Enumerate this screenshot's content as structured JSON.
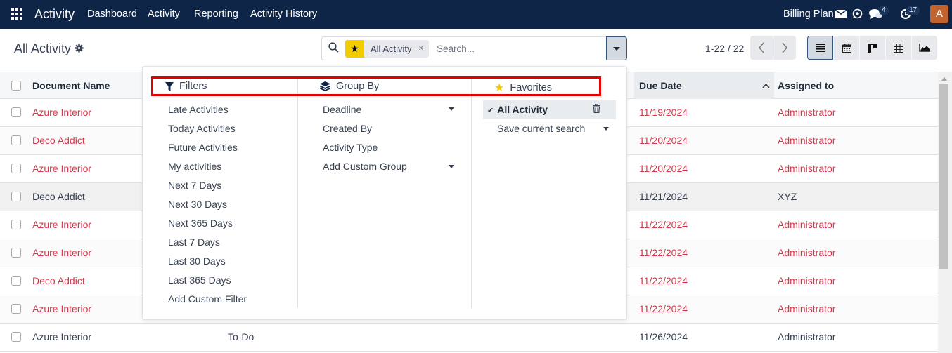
{
  "navbar": {
    "brand": "Activity",
    "menu": [
      "Dashboard",
      "Activity",
      "Reporting",
      "Activity History"
    ],
    "company": "Billing Plan",
    "messages_badge": "4",
    "activities_badge": "17",
    "avatar_letter": "A",
    "avatar_color": "#c0632c",
    "background_color": "#0f2548"
  },
  "control_panel": {
    "title": "All Activity",
    "search": {
      "facet_label": "All Activity",
      "facet_remove": "×",
      "placeholder": "Search..."
    },
    "pager": "1-22 / 22",
    "views": [
      "list-view",
      "calendar-view",
      "kanban-view",
      "pivot-view",
      "graph-view"
    ],
    "active_view": "list-view"
  },
  "dropdown": {
    "filters": {
      "title": "Filters",
      "items": [
        "Late Activities",
        "Today Activities",
        "Future Activities",
        "My activities",
        "Next 7 Days",
        "Next 30 Days",
        "Next 365 Days",
        "Last 7 Days",
        "Last 30 Days",
        "Last 365 Days",
        "Add Custom Filter"
      ]
    },
    "group_by": {
      "title": "Group By",
      "items": [
        "Deadline",
        "Created By",
        "Activity Type",
        "Add Custom Group"
      ]
    },
    "favorites": {
      "title": "Favorites",
      "items": [
        "All Activity",
        "Save current search"
      ],
      "active": "All Activity"
    },
    "highlight_color": "#e50000"
  },
  "table": {
    "columns": [
      "Document Name",
      "Due Date",
      "Assigned to"
    ],
    "sorted_column": "Due Date",
    "rows": [
      {
        "document": "Azure Interior",
        "activity_type": "",
        "due_date": "11/19/2024",
        "assigned": "Administrator",
        "late": true
      },
      {
        "document": "Deco Addict",
        "activity_type": "",
        "due_date": "11/20/2024",
        "assigned": "Administrator",
        "late": true
      },
      {
        "document": "Azure Interior",
        "activity_type": "",
        "due_date": "11/20/2024",
        "assigned": "Administrator",
        "late": true
      },
      {
        "document": "Deco Addict",
        "activity_type": "",
        "due_date": "11/21/2024",
        "assigned": "XYZ",
        "late": false
      },
      {
        "document": "Azure Interior",
        "activity_type": "",
        "due_date": "11/22/2024",
        "assigned": "Administrator",
        "late": true
      },
      {
        "document": "Azure Interior",
        "activity_type": "",
        "due_date": "11/22/2024",
        "assigned": "Administrator",
        "late": true
      },
      {
        "document": "Deco Addict",
        "activity_type": "",
        "due_date": "11/22/2024",
        "assigned": "Administrator",
        "late": true
      },
      {
        "document": "Azure Interior",
        "activity_type": "",
        "due_date": "11/22/2024",
        "assigned": "Administrator",
        "late": true
      },
      {
        "document": "Azure Interior",
        "activity_type": "To-Do",
        "due_date": "11/26/2024",
        "assigned": "Administrator",
        "late": false
      }
    ],
    "late_color": "#d6374a"
  }
}
